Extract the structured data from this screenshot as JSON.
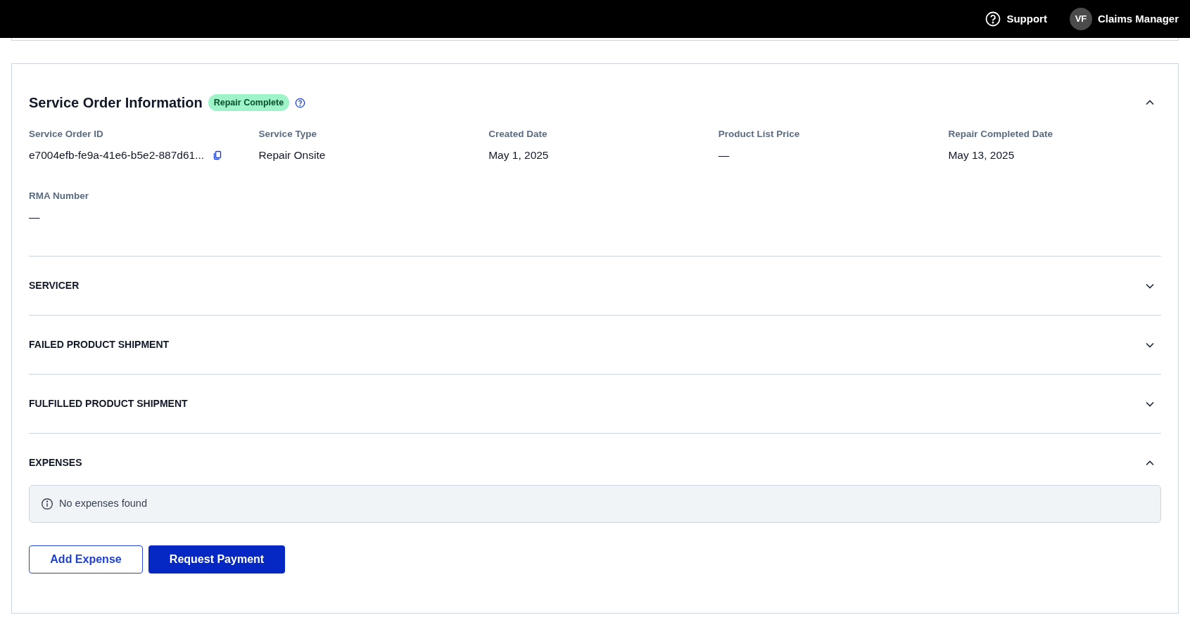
{
  "top_bar": {
    "support": "Support",
    "user": {
      "initials": "VF",
      "role": "Claims Manager"
    }
  },
  "service_order": {
    "title": "Service Order Information",
    "status": "Repair Complete",
    "expanded": true,
    "fields": [
      {
        "label": "Service Order ID",
        "value": "e7004efb-fe9a-41e6-b5e2-887d61...",
        "kind": "copy"
      },
      {
        "label": "Service Type",
        "value": "Repair Onsite",
        "kind": "text"
      },
      {
        "label": "Created Date",
        "value": "May 1, 2025",
        "kind": "text"
      },
      {
        "label": "Product List Price",
        "value": "—",
        "kind": "text"
      },
      {
        "label": "Repair Completed Date",
        "value": "May 13, 2025",
        "kind": "text"
      },
      {
        "label": "RMA Number",
        "value": "—",
        "kind": "text"
      }
    ]
  },
  "sections": [
    {
      "title": "SERVICER",
      "expanded": false
    },
    {
      "title": "FAILED PRODUCT SHIPMENT",
      "expanded": false
    },
    {
      "title": "FULFILLED PRODUCT SHIPMENT",
      "expanded": false
    },
    {
      "title": "EXPENSES",
      "expanded": true,
      "notice": "No expenses found"
    }
  ],
  "buttons": [
    {
      "label": "Add Expense",
      "kind": "secondary"
    },
    {
      "label": "Request Payment",
      "kind": "primary"
    }
  ]
}
